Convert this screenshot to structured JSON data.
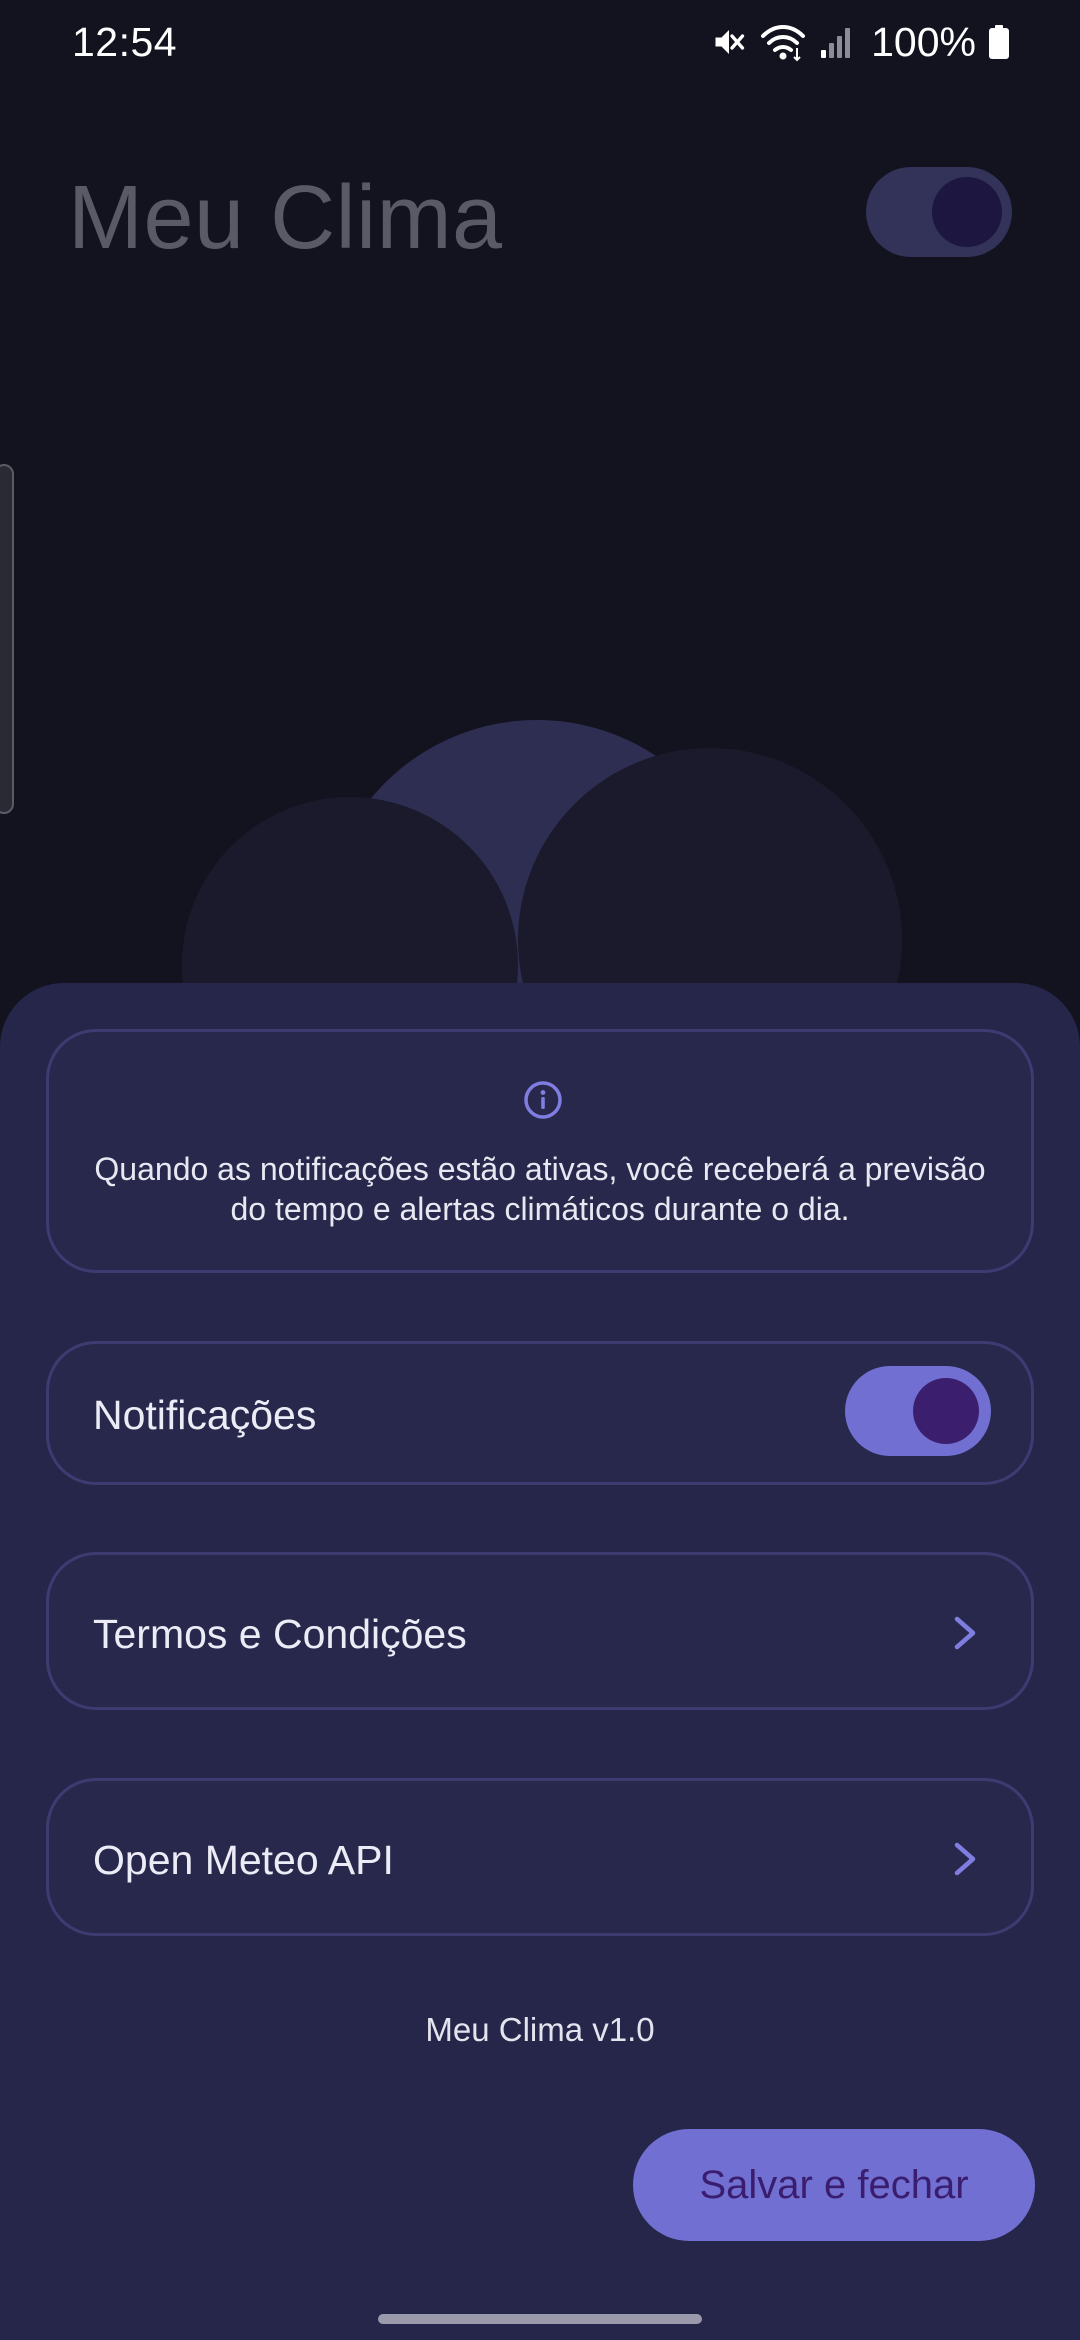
{
  "status_bar": {
    "time": "12:54",
    "battery": "100%",
    "icons": [
      "mute-icon",
      "wifi-icon",
      "signal-icon",
      "battery-icon"
    ]
  },
  "app": {
    "title": "Meu Clima"
  },
  "sheet": {
    "info_text": "Quando as notificações estão ativas, você receberá a previsão do tempo e alertas climáticos durante o dia.",
    "notifications_label": "Notificações",
    "notifications_enabled": true,
    "terms_label": "Termos e Condições",
    "api_label": "Open Meteo API",
    "version": "Meu Clima v1.0",
    "save_button": "Salvar e fechar"
  },
  "colors": {
    "background": "#13131f",
    "sheet": "#26264a",
    "card_border": "#3c3c72",
    "accent": "#7170d2",
    "accent_dark": "#3b1e6e"
  }
}
